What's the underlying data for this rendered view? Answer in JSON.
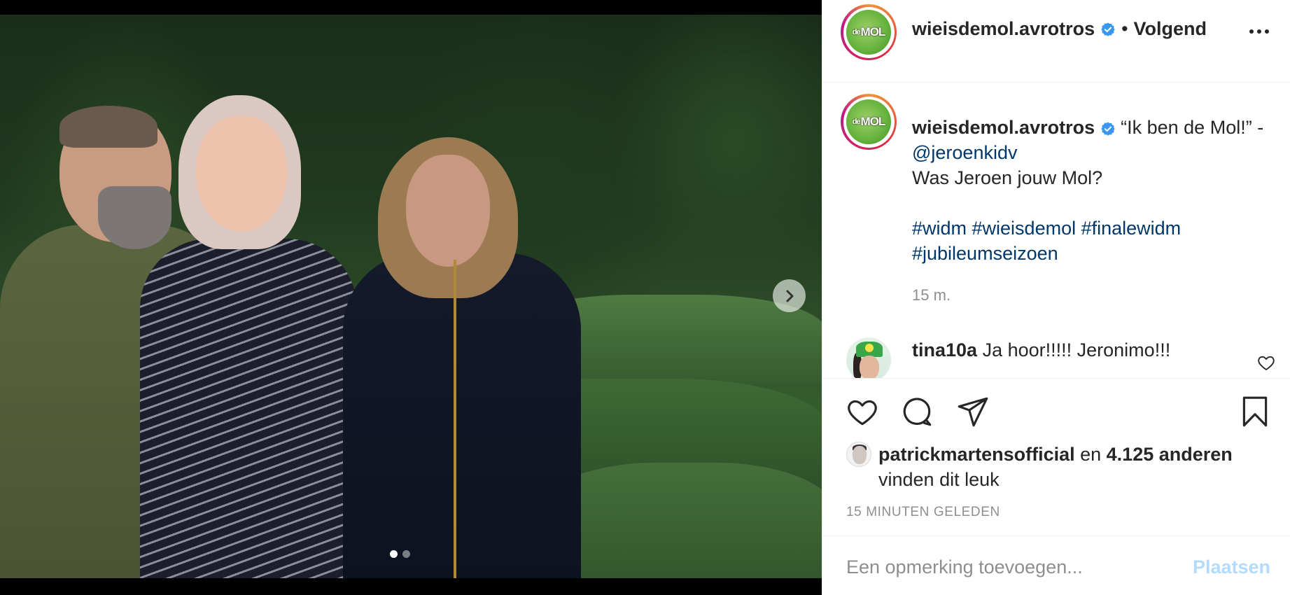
{
  "post": {
    "carousel": {
      "next_icon": "chevron-right-icon",
      "slide_count": 2,
      "active_slide": 1
    },
    "header": {
      "username": "wieisdemol.avrotros",
      "bullet": "•",
      "follow_label": "Volgend",
      "avatar_text_small": "de",
      "avatar_text": "MOL"
    },
    "caption": {
      "username": "wieisdemol.avrotros",
      "text_part1": "“Ik ben de Mol!” - ",
      "mention": "@jeroenkidv",
      "line2": "Was Jeroen jouw Mol?",
      "hashtags_line1": "#widm #wieisdemol #finalewidm",
      "hashtags_line2": "#jubileumseizoen",
      "time": "15 m."
    },
    "comments": [
      {
        "username": "tina10a",
        "text": "Ja hoor!!!!! Jeronimo!!!"
      }
    ],
    "actions": {
      "like_icon": "heart-icon",
      "comment_icon": "comment-icon",
      "share_icon": "send-icon",
      "save_icon": "bookmark-icon"
    },
    "likes": {
      "liked_by": "patrickmartensofficial",
      "connector": " en ",
      "others": "4.125 anderen",
      "suffix": "vinden dit leuk"
    },
    "timestamp": "15 MINUTEN GELEDEN",
    "add_comment": {
      "placeholder": "Een opmerking toevoegen...",
      "post_label": "Plaatsen"
    }
  },
  "colors": {
    "text": "#262626",
    "secondary": "#8e8e8e",
    "link": "#00376b",
    "verified": "#3897f0",
    "post_button_disabled": "#b3dbff",
    "border": "#efefef"
  }
}
